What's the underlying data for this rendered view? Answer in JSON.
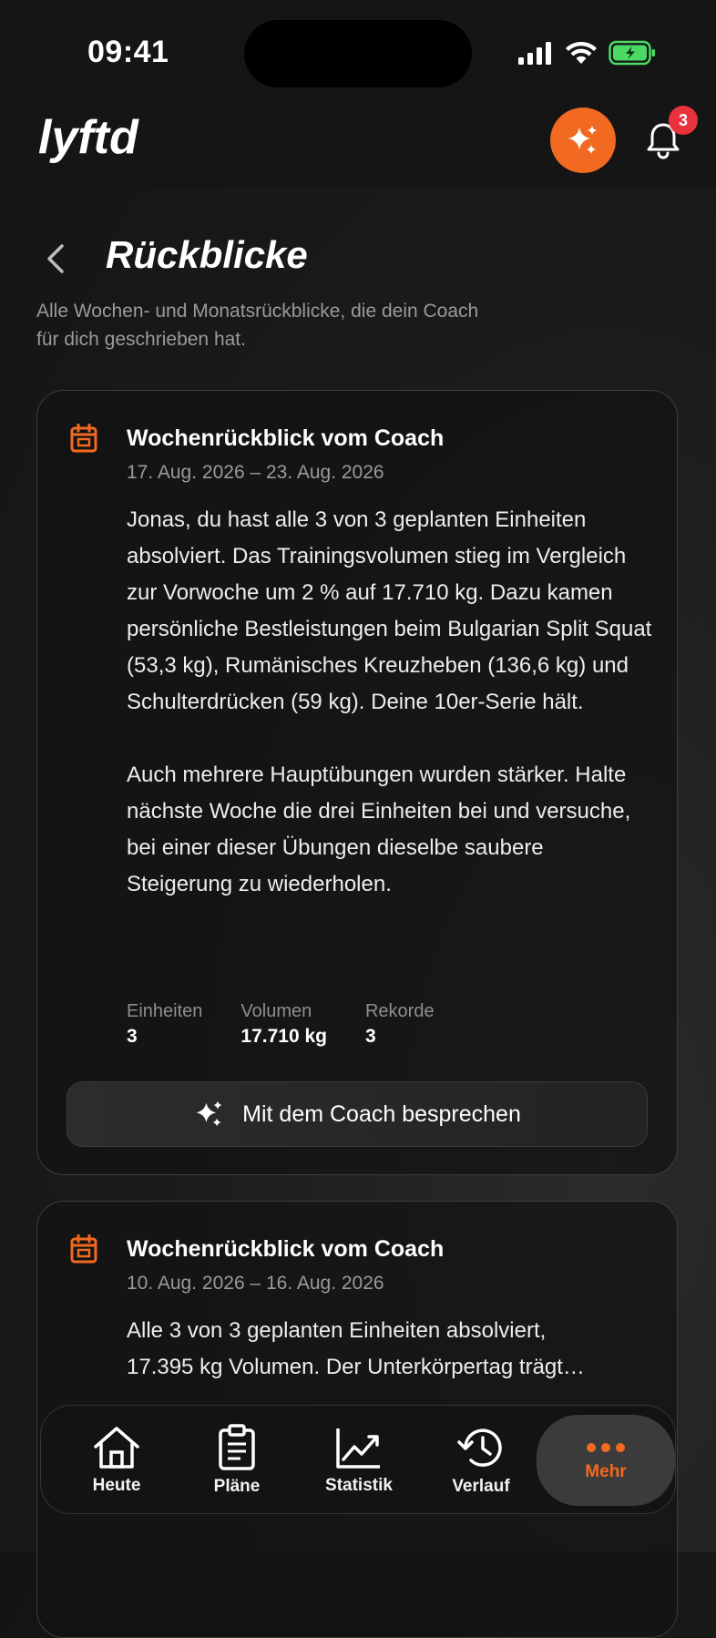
{
  "status": {
    "time": "09:41"
  },
  "header": {
    "logo_text": "lyftd",
    "notification_count": "3"
  },
  "page": {
    "title": "Rückblicke",
    "subtitle_line1": "Alle Wochen- und Monatsrückblicke, die dein Coach",
    "subtitle_line2": "für dich geschrieben hat."
  },
  "reviews": [
    {
      "title": "Wochenrückblick vom Coach",
      "date": "17. Aug. 2026 – 23. Aug. 2026",
      "para1": "Jonas, du hast alle 3 von 3 geplanten Einheiten absolviert. Das Trainingsvolumen stieg im Vergleich zur Vorwoche um 2 % auf 17.710 kg. Dazu kamen persönliche Bestleistungen beim Bulgarian Split Squat (53,3 kg), Rumänisches Kreuzheben (136,6 kg) und Schulterdrücken (59 kg). Deine 10er-Serie hält.",
      "para2": "Auch mehrere Hauptübungen wurden stärker. Halte nächste Woche die drei Einheiten bei und versuche, bei einer dieser Übungen dieselbe saubere Steigerung zu wiederholen.",
      "stats": [
        {
          "label": "Einheiten",
          "value": "3"
        },
        {
          "label": "Volumen",
          "value": "17.710 kg"
        },
        {
          "label": "Rekorde",
          "value": "3"
        }
      ],
      "button_label": "Mit dem Coach besprechen"
    },
    {
      "title": "Wochenrückblick vom Coach",
      "date": "10. Aug. 2026 – 16. Aug. 2026",
      "line1": "Alle 3 von 3 geplanten Einheiten absolviert,",
      "line2": "17.395 kg Volumen. Der Unterkörpertag trägt…"
    }
  ],
  "tabbar": {
    "items": [
      {
        "label": "Heute",
        "icon": "home-icon"
      },
      {
        "label": "Pläne",
        "icon": "clipboard-icon"
      },
      {
        "label": "Statistik",
        "icon": "chart-icon"
      },
      {
        "label": "Verlauf",
        "icon": "history-icon"
      },
      {
        "label": "Mehr",
        "icon": "more-icon"
      }
    ],
    "active": "Mehr"
  },
  "colors": {
    "accent": "#f26a21",
    "badge": "#e8323c",
    "battery": "#4cd964"
  }
}
